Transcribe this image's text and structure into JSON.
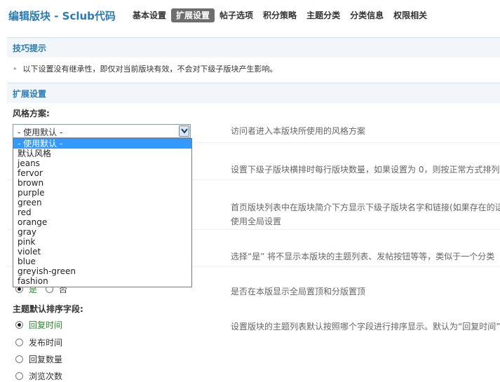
{
  "header": {
    "title": "编辑版块 - Sclub代码",
    "nav": [
      "基本设置",
      "扩展设置",
      "帖子选项",
      "积分策略",
      "主题分类",
      "分类信息",
      "权限相关"
    ],
    "active_nav": "扩展设置"
  },
  "tips": {
    "title": "技巧提示",
    "text": "以下设置没有继承性，即仅对当前版块有效，不会对下级子版块产生影响。"
  },
  "ext": {
    "title": "扩展设置",
    "style_label": "风格方案:",
    "style_selected": "- 使用默认 -",
    "style_desc": "访问者进入本版块所使用的风格方案",
    "style_options": [
      "- 使用默认 -",
      "默认风格",
      "jeans",
      "fervor",
      "brown",
      "purple",
      "green",
      "red",
      "orange",
      "gray",
      "pink",
      "violet",
      "blue",
      "greyish-green",
      "fashion"
    ],
    "sub_cols_desc": "设置下级子版块横排时每行版块数量，如果设置为 0，则按正常方式排列",
    "sub_names_desc": "首页版块列表中在版块简介下方显示下级子版块名字和链接(如果存在的话",
    "sub_names_desc2": "使用全局设置",
    "as_category_desc": "选择“是” 将不显示本版块的主题列表、发帖按钮等等，类似于一个分类",
    "sticky_yes": "是",
    "sticky_no": "否",
    "sticky_desc": "是否在本版显示全局置顶和分版置顶",
    "sort_label": "主题默认排序字段:",
    "sort_options": [
      "回复时间",
      "发布时间",
      "回复数量",
      "浏览次数"
    ],
    "sort_desc": "设置版块的主题列表默认按照哪个字段进行排序显示。默认为“回复时间”"
  }
}
